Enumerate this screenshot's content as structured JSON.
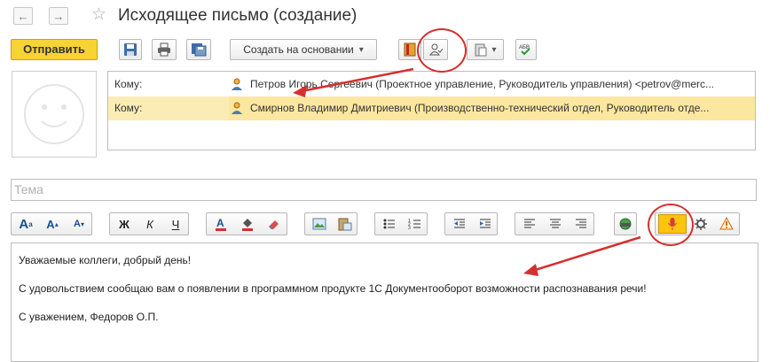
{
  "window": {
    "title": "Исходящее письмо (создание)"
  },
  "nav": {
    "back_icon": "←",
    "forward_icon": "→",
    "star_icon": "☆"
  },
  "toolbar": {
    "send_label": "Отправить",
    "create_based_label": "Создать на основании",
    "dropdown_icon": "▾"
  },
  "recipients": [
    {
      "label": "Кому:",
      "value": "Петров Игорь Сергеевич (Проектное управление, Руководитель управления) <petrov@merc...",
      "selected": false
    },
    {
      "label": "Кому:",
      "value": "Смирнов Владимир Дмитриевич (Производственно-технический отдел, Руководитель отде...",
      "selected": true
    }
  ],
  "subject": {
    "placeholder": "Тема"
  },
  "format_toolbar": {
    "bold": "Ж",
    "italic": "К",
    "underline": "Ч",
    "font_larger": "A",
    "font_increase": "A",
    "font_decrease": "A"
  },
  "body": {
    "lines": [
      "Уважаемые коллеги, добрый день!",
      "С удовольствием сообщаю вам о появлении в программном продукте 1С Документооборот возможности распознавания речи!",
      "С уважением, Федоров О.П."
    ]
  },
  "colors": {
    "accent_yellow": "#f7d334",
    "selected_row": "#fbecb5",
    "annotation_red": "#d62f2f",
    "mic_yellow": "#ffc40e"
  }
}
